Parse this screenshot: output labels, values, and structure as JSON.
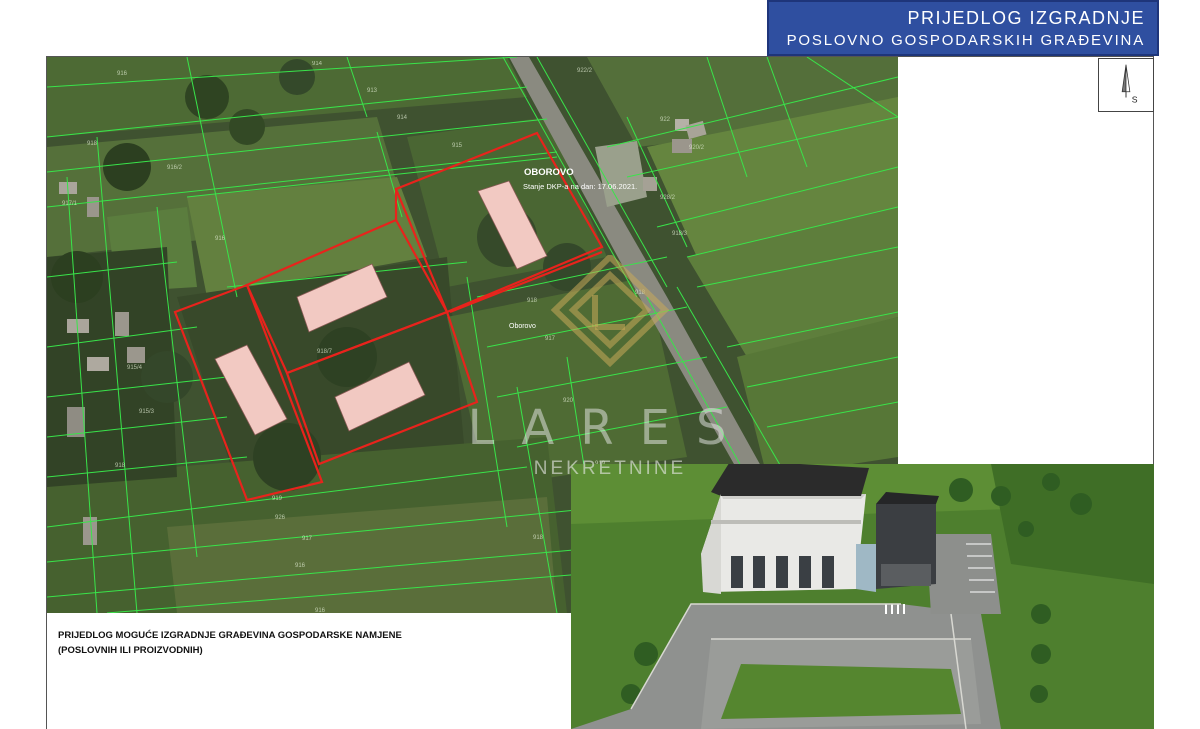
{
  "header": {
    "title_line1": "PRIJEDLOG IZGRADNJE",
    "title_line2": "POSLOVNO GOSPODARSKIH GRAĐEVINA"
  },
  "north_arrow": {
    "letter": "S",
    "icon": "north-arrow-icon"
  },
  "map": {
    "place_name": "OBOROVO",
    "dkp_status": "Stanje DKP-a na dan: 17.06.2021.",
    "place_label": "Oborovo",
    "parcel_outline_color": "#e8231c",
    "parcel_line_color": "#39e44a",
    "building_fill_color": "#f2c9c2"
  },
  "caption": {
    "line1": "PRIJEDLOG MOGUĆE IZGRADNJE GRAĐEVINA GOSPODARSKE NAMJENE",
    "line2": "(POSLOVNIH ILI PROIZVODNIH)"
  },
  "watermark": {
    "logo_icon": "lares-logo-icon",
    "brand": "LARES",
    "sub": "NEKRETNINE"
  }
}
